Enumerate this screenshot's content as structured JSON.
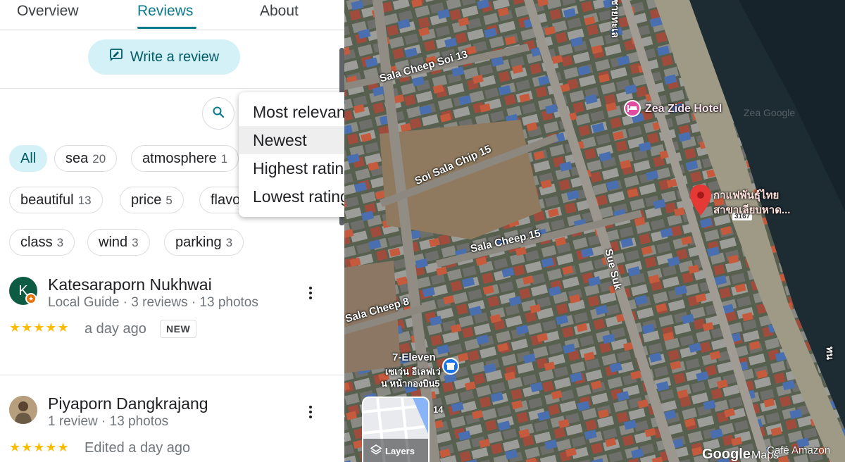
{
  "tabs": [
    {
      "label": "Overview",
      "active": false
    },
    {
      "label": "Reviews",
      "active": true
    },
    {
      "label": "About",
      "active": false
    }
  ],
  "write_review": {
    "label": "Write a review",
    "icon": "edit-review-icon"
  },
  "search_icon": "search-icon",
  "sort_menu": {
    "options": [
      "Most relevant",
      "Newest",
      "Highest rating",
      "Lowest rating"
    ],
    "highlighted": "Newest"
  },
  "topics": [
    {
      "label": "All",
      "selected": true
    },
    {
      "label": "sea",
      "count": "20"
    },
    {
      "label": "atmosphere",
      "count": "1"
    },
    {
      "label": "beautiful",
      "count": "13"
    },
    {
      "label": "price",
      "count": "5"
    },
    {
      "label": "flavo"
    },
    {
      "label": "class",
      "count": "3"
    },
    {
      "label": "wind",
      "count": "3"
    },
    {
      "label": "parking",
      "count": "3"
    }
  ],
  "reviews": [
    {
      "name": "Katesaraporn Nukhwai",
      "avatar_letter": "K",
      "meta": "Local Guide · 3 reviews · 13 photos",
      "rating": 5,
      "stars": "★★★★★",
      "when": "a day ago",
      "badge": "NEW"
    },
    {
      "name": "Piyaporn Dangkrajang",
      "meta": "1 review · 13 photos",
      "rating": 5,
      "stars": "★★★★★",
      "when": "Edited a day ago"
    }
  ],
  "map": {
    "streets": [
      "Sala Cheep Soi 13",
      "Soi Sala Chip 15",
      "Sala Cheep 15",
      "Sala Cheep 8",
      "Sue Suk",
      "3167"
    ],
    "places": [
      {
        "name": "Zea Zide Hotel"
      },
      {
        "name": "กาแฟพันธุ์ไทย",
        "sub": "สาขาเลียบหาด..."
      },
      {
        "name": "7-Eleven",
        "sub1": "เซเว่น อีเลฟเว่",
        "sub2": "น หน้ากองบิน5"
      }
    ],
    "edge_labels": [
      "ชายทะเล",
      "ทน"
    ],
    "layers_label": "Layers",
    "watermark": "Google",
    "attribution": "Google Maps",
    "attribution2": "Café Amazon",
    "ghost": "Zea Google",
    "partial_street": "14"
  }
}
